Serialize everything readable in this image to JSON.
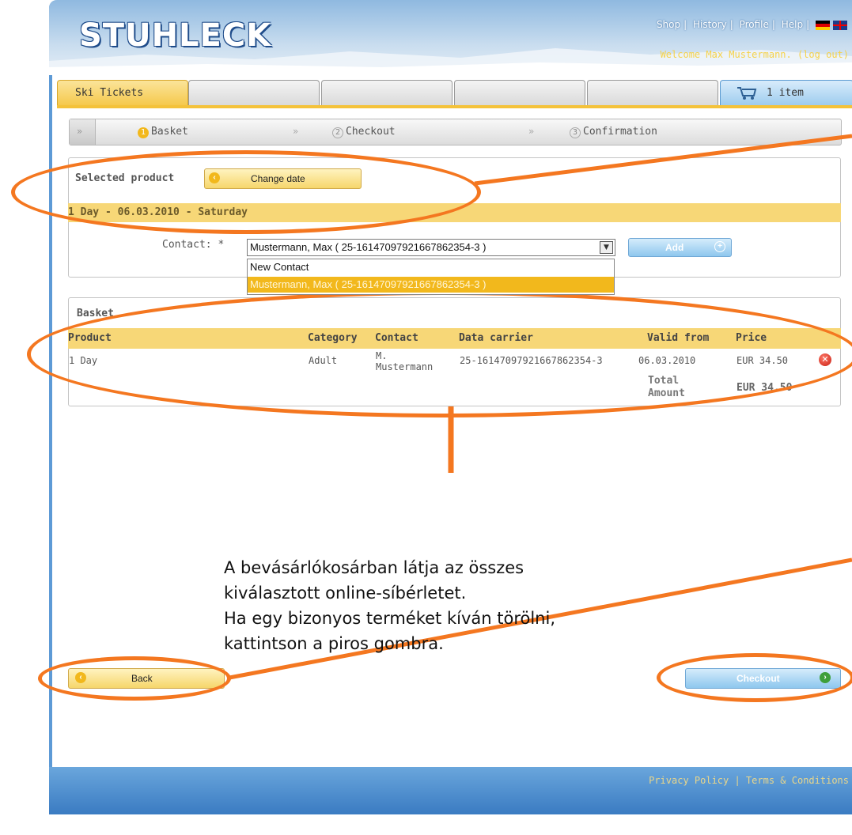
{
  "header": {
    "logo_text": "STUHLECK",
    "nav": [
      "Shop",
      "History",
      "Profile",
      "Help"
    ],
    "nav_separator": "|",
    "welcome": "Welcome Max Mustermann. (log out)"
  },
  "tabs": {
    "active_label": "Ski Tickets",
    "cart_label": "1 item"
  },
  "steps": [
    {
      "num": "1",
      "label": "Basket"
    },
    {
      "num": "2",
      "label": "Checkout"
    },
    {
      "num": "3",
      "label": "Confirmation"
    }
  ],
  "step_separator": "»",
  "selected_product": {
    "title": "Selected product",
    "change_date_label": "Change date",
    "day_line": "1 Day - 06.03.2010 - Saturday",
    "contact_label": "Contact: *",
    "contact_value": "Mustermann, Max ( 25-16147097921667862354-3 )",
    "dropdown_options": [
      "New Contact",
      "Mustermann, Max ( 25-16147097921667862354-3 )"
    ],
    "add_label": "Add"
  },
  "basket": {
    "title": "Basket",
    "columns": [
      "Product",
      "Category",
      "Contact",
      "Data carrier",
      "Valid from",
      "Price"
    ],
    "rows": [
      {
        "product": "1 Day",
        "category": "Adult",
        "contact_1": "M.",
        "contact_2": "Mustermann",
        "data_carrier": "25-16147097921667862354-3",
        "valid_from": "06.03.2010",
        "price": "EUR 34.50"
      }
    ],
    "total_label_1": "Total",
    "total_label_2": "Amount",
    "total_value": "EUR 34.50"
  },
  "buttons": {
    "back_label": "Back",
    "checkout_label": "Checkout"
  },
  "footer": {
    "privacy": "Privacy Policy",
    "separator": "|",
    "terms": "Terms & Conditions"
  },
  "annotation": {
    "line_1": "A bevásárlókosárban látja az összes",
    "line_2": "kiválasztott online-síbérletet.",
    "line_3": "Ha egy bizonyos terméket kíván törölni,",
    "line_4": "kattintson a piros gombra."
  },
  "colors": {
    "annotation_orange": "#f47720",
    "yellow_bar": "#f7d777",
    "frame_blue": "#5d9ad6"
  }
}
